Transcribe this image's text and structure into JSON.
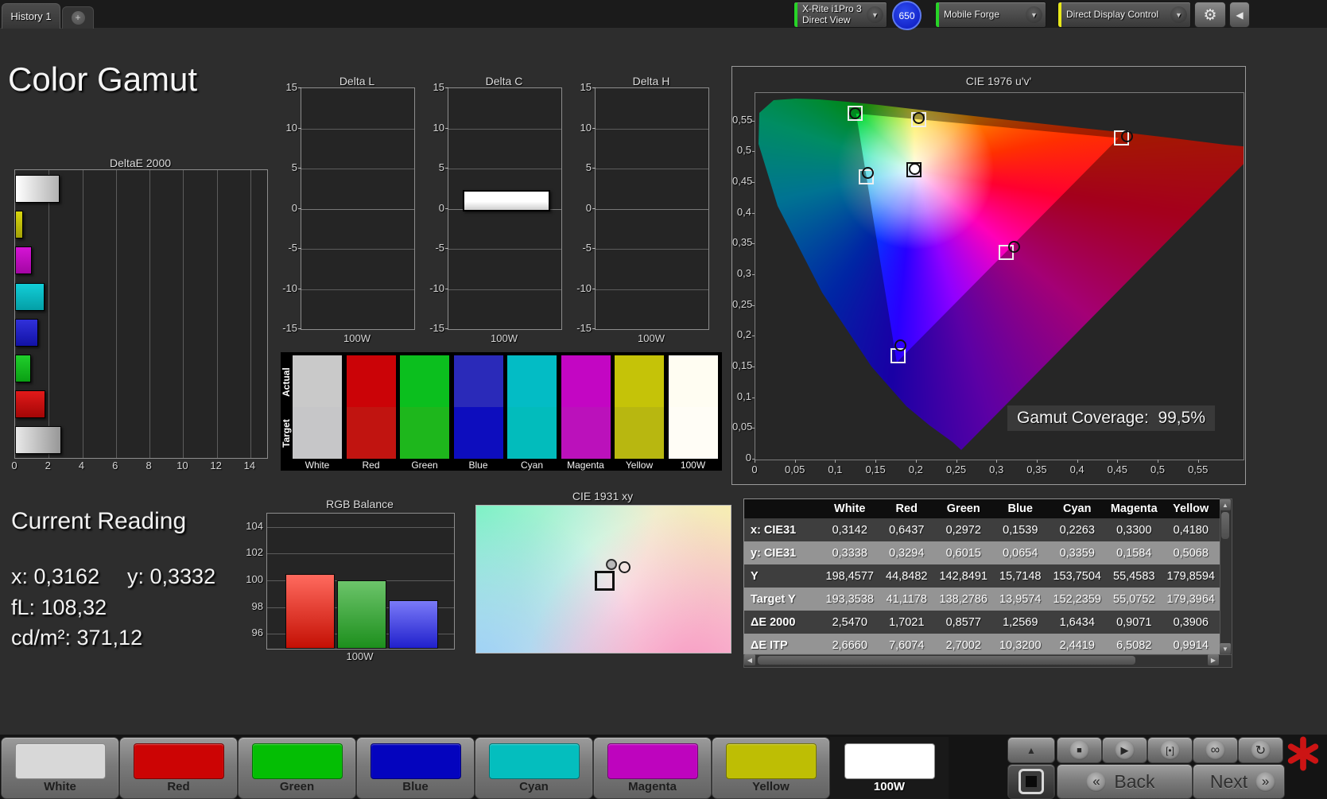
{
  "window": {
    "tab": "History 1",
    "add_tab": "+",
    "toolbar": {
      "meter_line1": "X-Rite i1Pro 3",
      "meter_line2": "Direct View",
      "meter_badge": "650",
      "source_label": "Mobile Forge",
      "control_label": "Direct Display Control",
      "meter_indicator": "#27d427",
      "source_indicator": "#27d427",
      "control_indicator": "#e8e81a"
    }
  },
  "page_title": "Color Gamut",
  "deltae_chart": {
    "title": "DeltaE 2000",
    "x_ticks": [
      {
        "t": "0",
        "v": 0
      },
      {
        "t": "2",
        "v": 2
      },
      {
        "t": "4",
        "v": 4
      },
      {
        "t": "6",
        "v": 6
      },
      {
        "t": "8",
        "v": 8
      },
      {
        "t": "10",
        "v": 10
      },
      {
        "t": "12",
        "v": 12
      },
      {
        "t": "14",
        "v": 14
      }
    ],
    "x_max": 15,
    "bars": [
      {
        "name": "White",
        "value": 2.547,
        "c1": "#ffffff",
        "c2": "#b2b2b2",
        "grad": "h"
      },
      {
        "name": "Yellow",
        "value": 0.3906,
        "c1": "#d8d60f",
        "c2": "#a3a106",
        "grad": "v"
      },
      {
        "name": "Magenta",
        "value": 0.9071,
        "c1": "#d514d5",
        "c2": "#a306a3",
        "grad": "v"
      },
      {
        "name": "Cyan",
        "value": 1.6434,
        "c1": "#12ced8",
        "c2": "#049fa6",
        "grad": "v"
      },
      {
        "name": "Blue",
        "value": 1.2569,
        "c1": "#3030da",
        "c2": "#1212a5",
        "grad": "v"
      },
      {
        "name": "Green",
        "value": 0.8577,
        "c1": "#20cf2c",
        "c2": "#0a9f13",
        "grad": "v"
      },
      {
        "name": "Red",
        "value": 1.7021,
        "c1": "#e21a1a",
        "c2": "#a30606",
        "grad": "v"
      },
      {
        "name": "100W",
        "value": 2.666,
        "c1": "#e9e9e9",
        "c2": "#979797",
        "grad": "h"
      }
    ]
  },
  "delta_y_ticks": [
    {
      "t": "15",
      "v": 15
    },
    {
      "t": "10",
      "v": 10
    },
    {
      "t": "5",
      "v": 5
    },
    {
      "t": "0",
      "v": 0
    },
    {
      "t": "-5",
      "v": -5
    },
    {
      "t": "-10",
      "v": -10
    },
    {
      "t": "-15",
      "v": -15
    }
  ],
  "delta_charts": [
    {
      "title": "Delta L",
      "x_label": "100W",
      "value": 0
    },
    {
      "title": "Delta C",
      "x_label": "100W",
      "value": 2.3
    },
    {
      "title": "Delta H",
      "x_label": "100W",
      "value": 0
    }
  ],
  "swatches": {
    "row_label_top": "Actual",
    "row_label_bottom": "Target",
    "items": [
      {
        "label": "White",
        "actual": "#c9c9c9",
        "target": "#c6c6c8"
      },
      {
        "label": "Red",
        "actual": "#cb0307",
        "target": "#c11410"
      },
      {
        "label": "Green",
        "actual": "#0bbf1e",
        "target": "#1eb71c"
      },
      {
        "label": "Blue",
        "actual": "#2a2ab9",
        "target": "#0d0dbe"
      },
      {
        "label": "Cyan",
        "actual": "#03bcc5",
        "target": "#02bcbc"
      },
      {
        "label": "Magenta",
        "actual": "#c306c3",
        "target": "#bb11bb"
      },
      {
        "label": "Yellow",
        "actual": "#c5c308",
        "target": "#b8b710"
      },
      {
        "label": "100W",
        "actual": "#fffdf2",
        "target": "#fffdf6"
      }
    ]
  },
  "cie1976": {
    "title": "CIE 1976 u'v'",
    "x_ticks": [
      {
        "t": "0",
        "v": 0
      },
      {
        "t": "0,05",
        "v": 0.05
      },
      {
        "t": "0,1",
        "v": 0.1
      },
      {
        "t": "0,15",
        "v": 0.15
      },
      {
        "t": "0,2",
        "v": 0.2
      },
      {
        "t": "0,25",
        "v": 0.25
      },
      {
        "t": "0,3",
        "v": 0.3
      },
      {
        "t": "0,35",
        "v": 0.35
      },
      {
        "t": "0,4",
        "v": 0.4
      },
      {
        "t": "0,45",
        "v": 0.45
      },
      {
        "t": "0,5",
        "v": 0.5
      },
      {
        "t": "0,55",
        "v": 0.55
      }
    ],
    "y_ticks": [
      {
        "t": "0,55",
        "v": 0.55
      },
      {
        "t": "0,5",
        "v": 0.5
      },
      {
        "t": "0,45",
        "v": 0.45
      },
      {
        "t": "0,4",
        "v": 0.4
      },
      {
        "t": "0,35",
        "v": 0.35
      },
      {
        "t": "0,3",
        "v": 0.3
      },
      {
        "t": "0,25",
        "v": 0.25
      },
      {
        "t": "0,2",
        "v": 0.2
      },
      {
        "t": "0,15",
        "v": 0.15
      },
      {
        "t": "0,1",
        "v": 0.1
      },
      {
        "t": "0,05",
        "v": 0.05
      },
      {
        "t": "0",
        "v": 0
      }
    ],
    "gamut_coverage_label": "Gamut Coverage:",
    "gamut_coverage_value": "99,5%",
    "gamut_triangle": [
      {
        "u": 0.125,
        "v": 0.5625
      },
      {
        "u": 0.4507,
        "v": 0.5229
      },
      {
        "u": 0.1754,
        "v": 0.1579
      }
    ],
    "markers": [
      {
        "name": "white",
        "u": 0.1971,
        "v": 0.4711,
        "square": "#0d0d0d",
        "circle_fill": "#ffffff",
        "dx": 1,
        "dy": -1
      },
      {
        "name": "red",
        "u": 0.4545,
        "v": 0.5233,
        "square": "#efefef",
        "circle_fill": "none",
        "dx": 7,
        "dy": -2
      },
      {
        "name": "green",
        "u": 0.1235,
        "v": 0.5625,
        "square": "#efefef",
        "circle_fill": "none",
        "dx": 0,
        "dy": 0
      },
      {
        "name": "blue",
        "u": 0.177,
        "v": 0.1693,
        "square": "#efefef",
        "circle_fill": "none",
        "dx": 3,
        "dy": -13
      },
      {
        "name": "cyan",
        "u": 0.1376,
        "v": 0.4596,
        "square": "#efefef",
        "circle_fill": "none",
        "dx": 2,
        "dy": -5
      },
      {
        "name": "magenta",
        "u": 0.3113,
        "v": 0.3362,
        "square": "#efefef",
        "circle_fill": "none",
        "dx": 10,
        "dy": -7
      },
      {
        "name": "yellow",
        "u": 0.2028,
        "v": 0.5531,
        "square": "#efefef",
        "circle_fill": "none",
        "dx": 0,
        "dy": -2
      }
    ]
  },
  "current_reading": {
    "title": "Current Reading",
    "x_reading": "x: 0,3162",
    "y_reading": "y: 0,3332",
    "fl_reading": "fL: 108,32",
    "cd_reading": "cd/m²: 371,12"
  },
  "rgb_balance": {
    "title": "RGB Balance",
    "x_label": "100W",
    "y_ticks": [
      {
        "t": "104",
        "v": 104
      },
      {
        "t": "102",
        "v": 102
      },
      {
        "t": "100",
        "v": 100
      },
      {
        "t": "98",
        "v": 98
      },
      {
        "t": "96",
        "v": 96
      }
    ],
    "y_min": 94.9,
    "y_max": 105,
    "bars": [
      {
        "name": "red",
        "value": 100.5,
        "c1": "#ff6a5e",
        "c2": "#c41004"
      },
      {
        "name": "green",
        "value": 100.0,
        "c1": "#6cc46a",
        "c2": "#1d8f1d"
      },
      {
        "name": "blue",
        "value": 98.5,
        "c1": "#7a7af8",
        "c2": "#2020cc"
      }
    ]
  },
  "cie1931": {
    "title": "CIE 1931 xy"
  },
  "table": {
    "columns": [
      "White",
      "Red",
      "Green",
      "Blue",
      "Cyan",
      "Magenta",
      "Yellow"
    ],
    "rows": [
      {
        "label": "x: CIE31",
        "shade": "dark",
        "values": [
          "0,3142",
          "0,6437",
          "0,2972",
          "0,1539",
          "0,2263",
          "0,3300",
          "0,4180"
        ]
      },
      {
        "label": "y: CIE31",
        "shade": "light",
        "values": [
          "0,3338",
          "0,3294",
          "0,6015",
          "0,0654",
          "0,3359",
          "0,1584",
          "0,5068"
        ]
      },
      {
        "label": "Y",
        "shade": "dark",
        "values": [
          "198,4577",
          "44,8482",
          "142,8491",
          "15,7148",
          "153,7504",
          "55,4583",
          "179,8594"
        ]
      },
      {
        "label": "Target Y",
        "shade": "light",
        "values": [
          "193,3538",
          "41,1178",
          "138,2786",
          "13,9574",
          "152,2359",
          "55,0752",
          "179,3964"
        ]
      },
      {
        "label": "ΔE 2000",
        "shade": "dark",
        "values": [
          "2,5470",
          "1,7021",
          "0,8577",
          "1,2569",
          "1,6434",
          "0,9071",
          "0,3906"
        ]
      },
      {
        "label": "ΔE ITP",
        "shade": "light",
        "values": [
          "2,6660",
          "7,6074",
          "2,7002",
          "10,3200",
          "2,4419",
          "6,5082",
          "0,9914"
        ]
      }
    ]
  },
  "pattern_buttons": [
    {
      "label": "White",
      "color": "#d8d8d8",
      "selected": false
    },
    {
      "label": "Red",
      "color": "#cc0404",
      "selected": false
    },
    {
      "label": "Green",
      "color": "#04be04",
      "selected": false
    },
    {
      "label": "Blue",
      "color": "#0404be",
      "selected": false
    },
    {
      "label": "Cyan",
      "color": "#04bebe",
      "selected": false
    },
    {
      "label": "Magenta",
      "color": "#be04be",
      "selected": false
    },
    {
      "label": "Yellow",
      "color": "#bebe04",
      "selected": false
    },
    {
      "label": "100W",
      "color": "#ffffff",
      "selected": true
    }
  ],
  "transport": {
    "glyph_buttons": [
      {
        "name": "stop-measure-button",
        "icon": "stop-icon",
        "glyph": "■",
        "size": 11
      },
      {
        "name": "measure-once-button",
        "icon": "play-icon",
        "glyph": "▶",
        "size": 13
      },
      {
        "name": "single-pattern-button",
        "icon": "bracket-dot-icon",
        "glyph": "[•]",
        "size": 12
      },
      {
        "name": "continuous-measure-button",
        "icon": "infinity-icon",
        "glyph": "∞",
        "size": 16
      },
      {
        "name": "refresh-button",
        "icon": "refresh-icon",
        "glyph": "↻",
        "size": 16
      }
    ],
    "back_label": "Back",
    "next_label": "Next",
    "back_chevron": "«",
    "next_chevron": "»",
    "up_chevron": "▲"
  }
}
